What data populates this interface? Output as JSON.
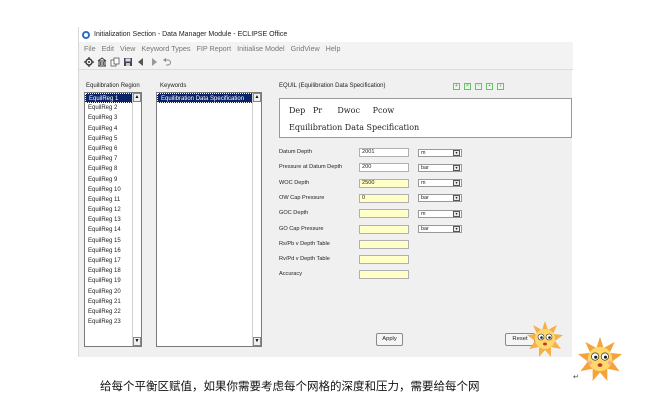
{
  "window": {
    "title": "Initialization Section - Data Manager Module - ECLIPSE Office"
  },
  "menu": [
    "File",
    "Edit",
    "View",
    "Keyword Types",
    "FIP Report",
    "Initialise Model",
    "GridView",
    "Help"
  ],
  "toolbar": {
    "icons": [
      "gear-icon",
      "building-icon",
      "copy-icon",
      "save-icon",
      "back-arrow-icon",
      "forward-arrow-icon",
      "undo-icon"
    ]
  },
  "regions": {
    "label": "Equilibration Region",
    "items": [
      "EquilReg 1",
      "EquilReg 2",
      "EquilReg 3",
      "EquilReg 4",
      "EquilReg 5",
      "EquilReg 6",
      "EquilReg 7",
      "EquilReg 8",
      "EquilReg 9",
      "EquilReg 10",
      "EquilReg 11",
      "EquilReg 12",
      "EquilReg 13",
      "EquilReg 14",
      "EquilReg 15",
      "EquilReg 16",
      "EquilReg 17",
      "EquilReg 18",
      "EquilReg 19",
      "EquilReg 20",
      "EquilReg 21",
      "EquilReg 22",
      "EquilReg 23"
    ],
    "selected": "EquilReg 1"
  },
  "keywords": {
    "label": "Keywords",
    "items": [
      "Equilibration Data Specification"
    ],
    "selected": "Equilibration Data Specification"
  },
  "equil": {
    "title": "EQUIL (Equilibration Data Specification)",
    "preview_line1": "Dep   Pr      Dwoc     Pcow",
    "preview_line2": "Equilibration Data Specification",
    "fields": [
      {
        "label": "Datum Depth",
        "value": "2001",
        "unit": "m"
      },
      {
        "label": "Pressure at Datum Depth",
        "value": "200",
        "unit": "bar"
      },
      {
        "label": "WOC Depth",
        "value": "2500",
        "unit": "m"
      },
      {
        "label": "OW Cap Pressure",
        "value": "0",
        "unit": "bar"
      },
      {
        "label": "GOC Depth",
        "value": "",
        "unit": "m"
      },
      {
        "label": "GO Cap Pressure",
        "value": "",
        "unit": "bar"
      },
      {
        "label": "Rs/Pb v Depth Table",
        "value": ""
      },
      {
        "label": "Rv/Pd v Depth Table",
        "value": ""
      },
      {
        "label": "Accuracy",
        "value": ""
      }
    ],
    "apply_label": "Apply",
    "reset_label": "Reset"
  },
  "caption": "给每个平衡区赋值，如果你需要考虑每个网格的深度和压力，需要给每个网",
  "caption_mark": "↵"
}
